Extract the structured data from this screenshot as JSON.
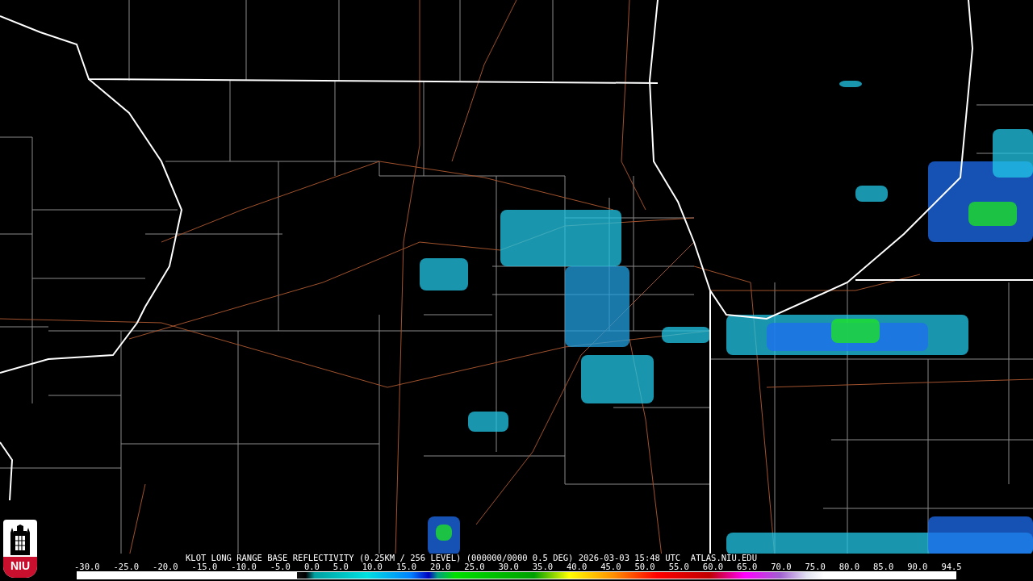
{
  "logo": {
    "text": "NIU"
  },
  "caption": "KLOT LONG RANGE BASE REFLECTIVITY (0.25KM / 256 LEVEL) (000000/0000 0.5 DEG) 2026-03-03 15:48 UTC  ATLAS.NIU.EDU",
  "scale": {
    "labels": [
      "-30.0",
      "-25.0",
      "-20.0",
      "-15.0",
      "-10.0",
      "-5.0",
      "0.0",
      "5.0",
      "10.0",
      "15.0",
      "20.0",
      "25.0",
      "30.0",
      "35.0",
      "40.0",
      "45.0",
      "50.0",
      "55.0",
      "60.0",
      "65.0",
      "70.0",
      "75.0",
      "80.0",
      "85.0",
      "90.0",
      "94.5"
    ]
  }
}
